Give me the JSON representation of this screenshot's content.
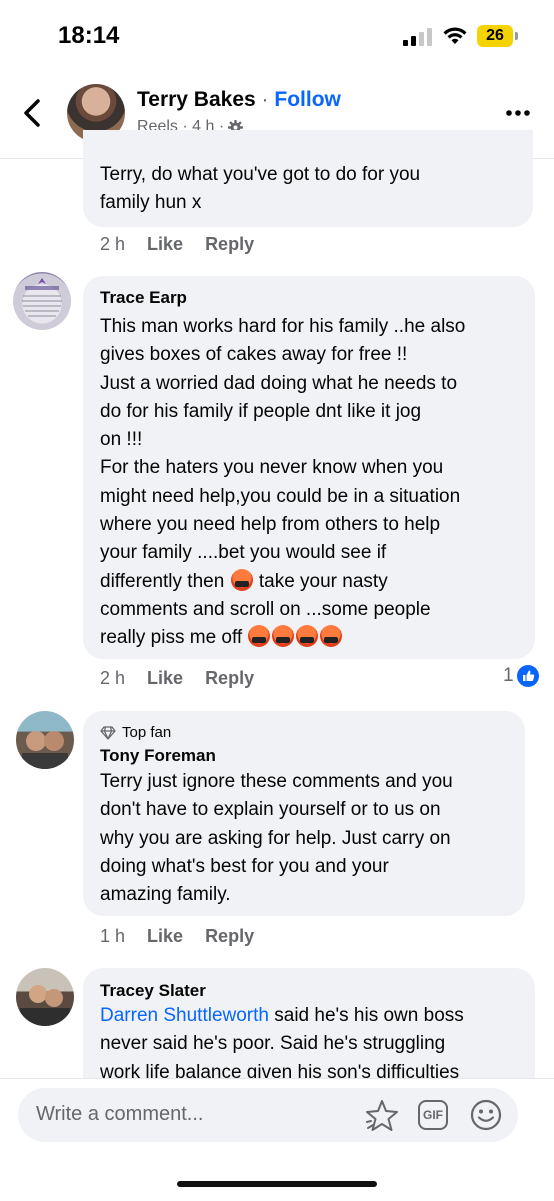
{
  "status_bar": {
    "time": "18:14",
    "battery": "26"
  },
  "header": {
    "name": "Terry Bakes",
    "separator": " · ",
    "follow": "Follow",
    "meta": "Reels · 4 h ·"
  },
  "comments": [
    {
      "author": "",
      "text_lines": [
        "Terry, do what you've got to do for you",
        "family hun x"
      ],
      "time": "2 h",
      "like": "Like",
      "reply": "Reply"
    },
    {
      "author": "Trace Earp",
      "text_lines": [
        "This man works hard for his family ..he also",
        "gives boxes of cakes away for free !!",
        "Just a worried dad doing what he needs to",
        "do for his family if people dnt like it jog",
        "on !!!",
        "For the haters you never know when you",
        "might need help,you could be in a situation",
        "where you need help from others to help",
        "your  family ....bet you would see if",
        "differently then",
        "take your nasty",
        "comments and scroll on ...some people",
        "really piss me off"
      ],
      "time": "2 h",
      "like": "Like",
      "reply": "Reply",
      "reaction_count": "1"
    },
    {
      "badge": "Top fan",
      "author": "Tony Foreman",
      "text_lines": [
        "Terry just ignore these comments and you",
        "don't have to explain yourself or to us on",
        "why you are asking for help. Just carry on",
        "doing what's best for you and your",
        "amazing family."
      ],
      "time": "1 h",
      "like": "Like",
      "reply": "Reply"
    },
    {
      "author": "Tracey Slater",
      "mention": "Darren Shuttleworth",
      "text_lines": [
        " said he's his own boss",
        "never said he's poor. Said he's struggling",
        "work life balance given his son's difficulties"
      ]
    }
  ],
  "comment_bar": {
    "placeholder": "Write a comment...",
    "gif": "GIF"
  },
  "colors": {
    "accent": "#0866ff",
    "bubble": "#f0f2f5",
    "meta": "#65676b"
  }
}
